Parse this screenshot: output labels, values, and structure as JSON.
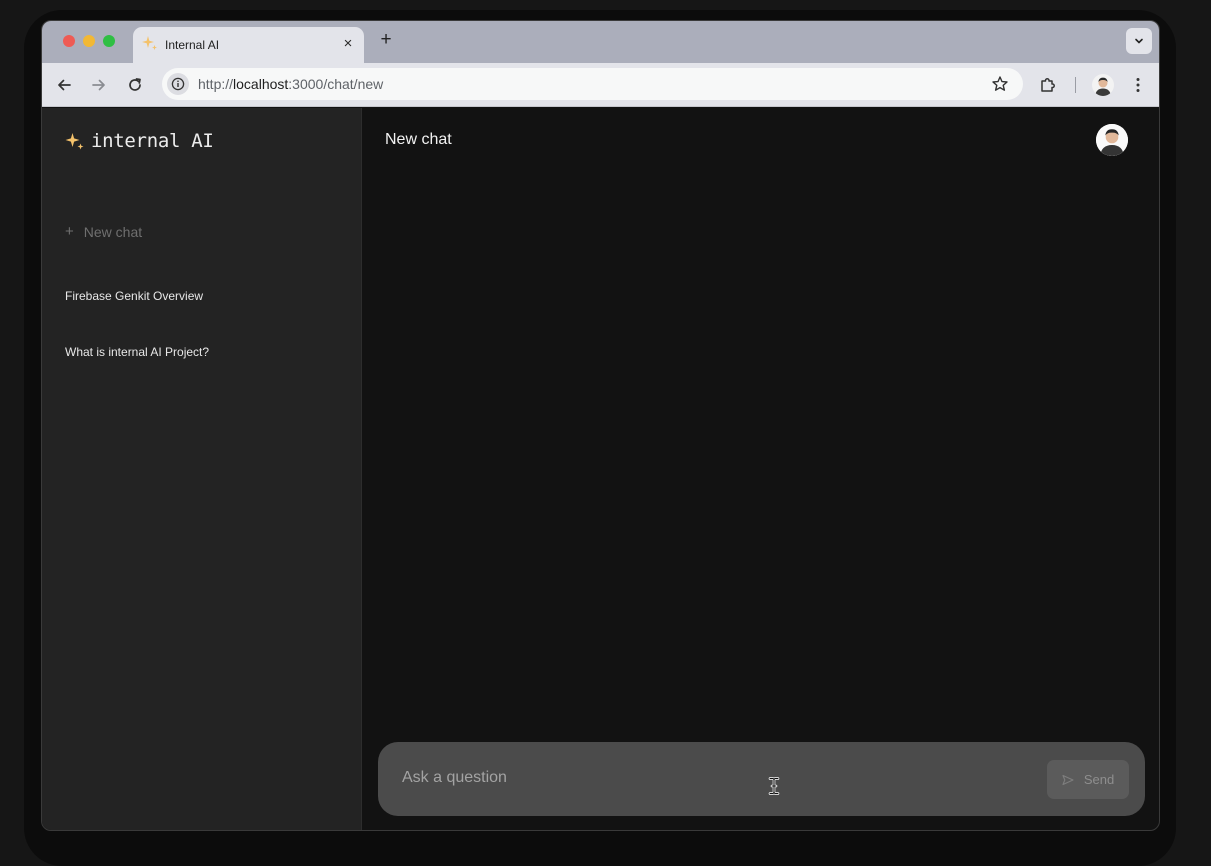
{
  "browser": {
    "tab_title": "Internal AI",
    "tab_close": "×",
    "new_tab": "+",
    "url_scheme": "http://",
    "url_host": "localhost",
    "url_rest": ":3000/chat/new"
  },
  "sidebar": {
    "logo_text": "internal AI",
    "new_chat_label": "New chat",
    "new_chat_plus": "+",
    "history": [
      {
        "title": "Firebase Genkit Overview"
      },
      {
        "title": "What is internal AI Project?"
      }
    ]
  },
  "main": {
    "title": "New chat",
    "composer": {
      "placeholder": "Ask a question",
      "send_label": "Send"
    }
  },
  "colors": {
    "accent_sparkle": "#f4c26b",
    "sidebar_bg": "#232323",
    "main_bg": "#121212",
    "composer_bg": "#4b4b4b"
  }
}
